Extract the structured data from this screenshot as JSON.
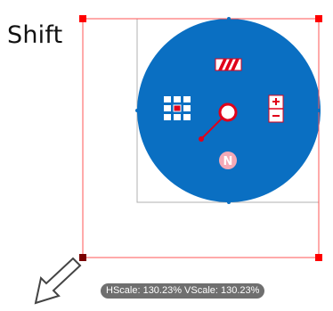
{
  "modifier_key": "Shift",
  "scale_readout": "HScale: 130.23% VScale: 130.23%",
  "control": {
    "center_badge": "N"
  },
  "colors": {
    "disc_fill": "#0a6fc2",
    "selection_red": "#ff0000",
    "original_bounds_gray": "#b0b0b0",
    "readout_bg": "#6f6f6f",
    "icon_white": "#ffffff",
    "icon_red": "#e0001a"
  }
}
